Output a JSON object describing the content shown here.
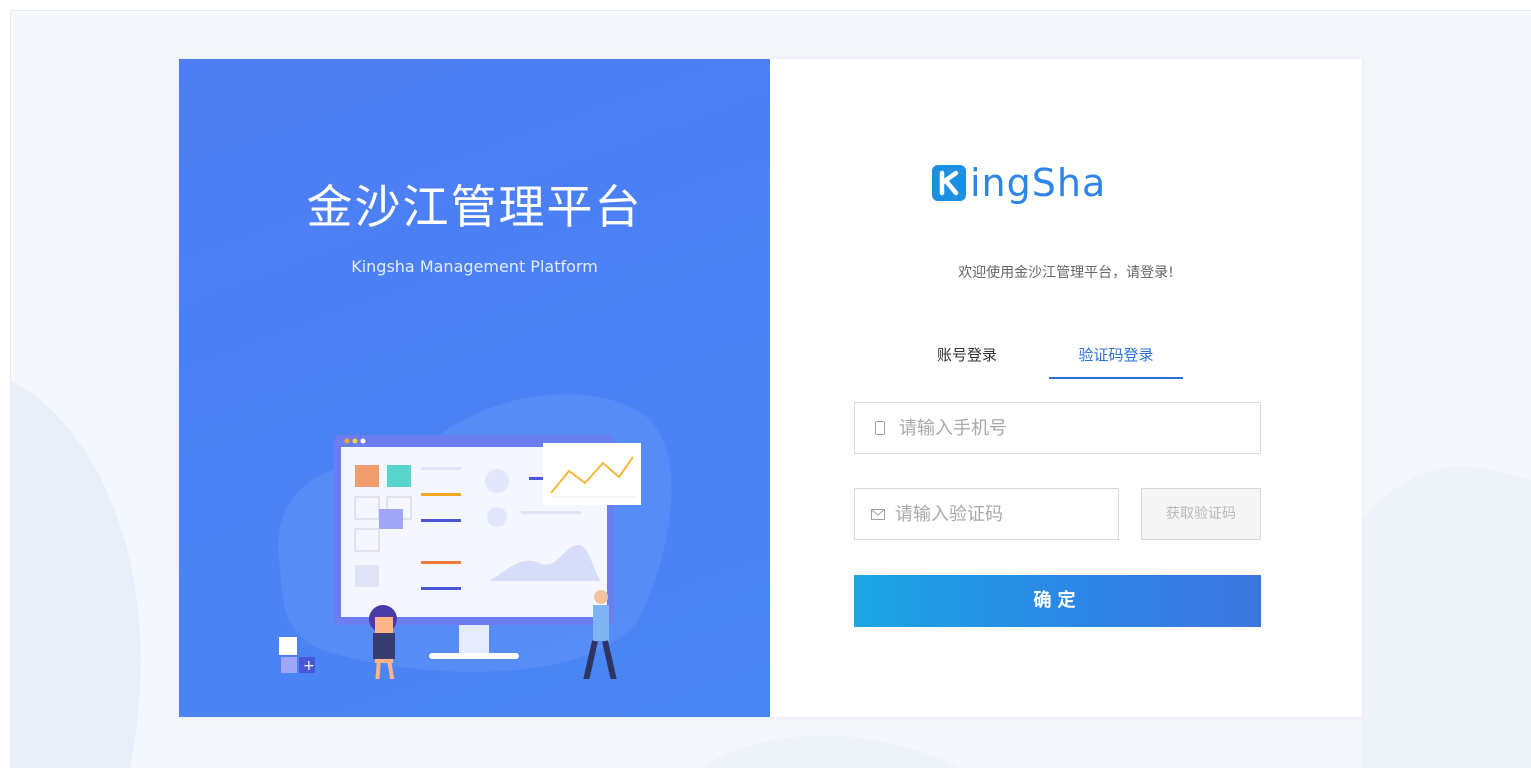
{
  "brand": {
    "title": "金沙江管理平台",
    "subtitle": "Kingsha Management Platform"
  },
  "logo": {
    "text": "ingSha"
  },
  "login": {
    "welcome": "欢迎使用金沙江管理平台，请登录!",
    "tabs": [
      {
        "label": "账号登录",
        "active": false
      },
      {
        "label": "验证码登录",
        "active": true
      }
    ],
    "phone": {
      "placeholder": "请输入手机号",
      "value": "",
      "icon": "mobile-phone-icon"
    },
    "code": {
      "placeholder": "请输入验证码",
      "value": "",
      "icon": "envelope-icon"
    },
    "get_code_label": "获取验证码",
    "confirm_label": "确定"
  },
  "colors": {
    "accent": "#2b6fd8",
    "brand_panel": "#4a82f5",
    "button_start": "#1ba6e4",
    "button_end": "#3d76e0"
  }
}
